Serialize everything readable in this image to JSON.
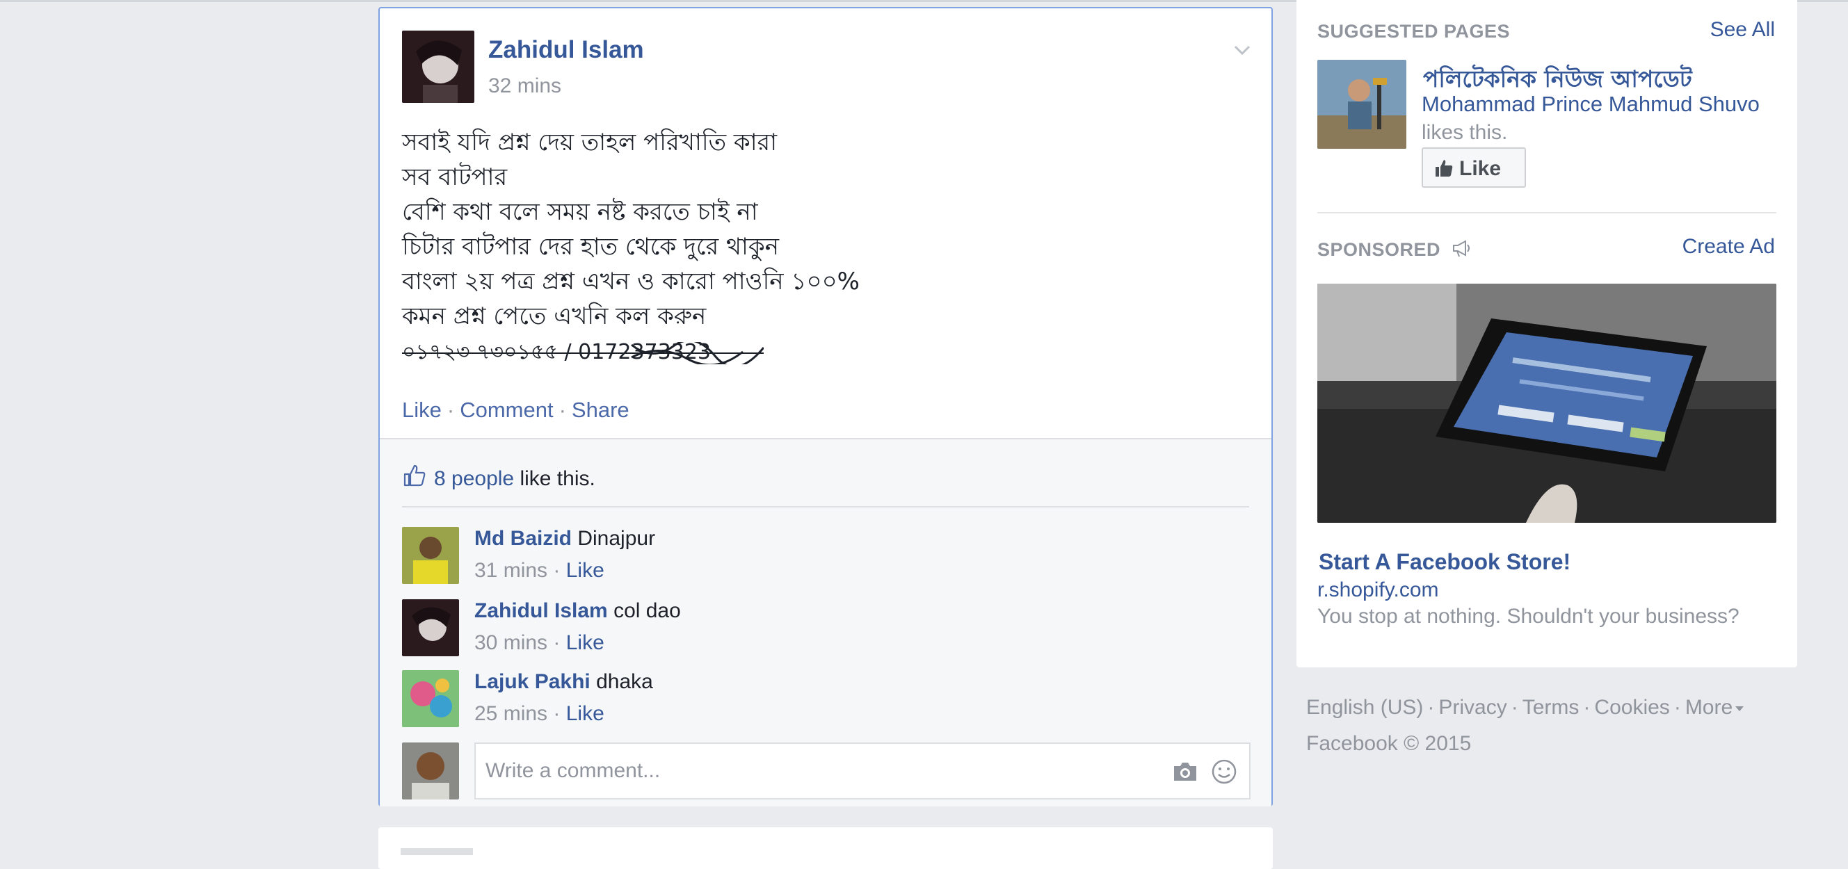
{
  "post": {
    "author": "Zahidul Islam",
    "time": "32 mins",
    "lines": [
      "সবাই যদি প্রশ্ন দেয় তাহল পরিখাতি কারা",
      "সব বাটপার",
      "বেশি কথা বলে সময় নষ্ট করতে চাই না",
      "চিটার বাটপার দের হাত থেকে দুরে থাকুন",
      "বাংলা ২য় পত্র প্রশ্ন এখন ও কারো পাওনি ১০০%",
      "কমন প্রশ্ন পেতে এখনি কল করুন"
    ],
    "phone_line": "০১৭২৩ ৭৩০১৫৫ / 0172373323",
    "actions": {
      "like": "Like",
      "comment": "Comment",
      "share": "Share",
      "separator": "·"
    }
  },
  "ufi": {
    "likes_count": "8 people",
    "likes_suffix": "like this.",
    "comments": [
      {
        "name": "Md Baizid",
        "text": "Dinajpur",
        "time": "31 mins",
        "like": "Like"
      },
      {
        "name": "Zahidul Islam",
        "text": "col dao",
        "time": "30 mins",
        "like": "Like"
      },
      {
        "name": "Lajuk Pakhi",
        "text": "dhaka",
        "time": "25 mins",
        "like": "Like"
      }
    ],
    "write_placeholder": "Write a comment..."
  },
  "sidebar": {
    "suggested_title": "SUGGESTED PAGES",
    "see_all": "See All",
    "page_name": "পলিটেকনিক নিউজ আপডেট",
    "page_friend": "Mohammad Prince Mahmud Shuvo",
    "page_likes": "likes this.",
    "like_button": "Like",
    "sponsored_title": "SPONSORED",
    "create_ad": "Create Ad",
    "ad_title": "Start A Facebook Store!",
    "ad_domain": "r.shopify.com",
    "ad_desc": "You stop at nothing. Shouldn't your business?"
  },
  "footer": {
    "links": [
      "English (US)",
      "Privacy",
      "Terms",
      "Cookies",
      "More"
    ],
    "copyright": "Facebook © 2015"
  },
  "colors": {
    "link": "#365899",
    "muted": "#90949c",
    "background": "#e9ebee",
    "focus_border": "#7fa2e0"
  }
}
